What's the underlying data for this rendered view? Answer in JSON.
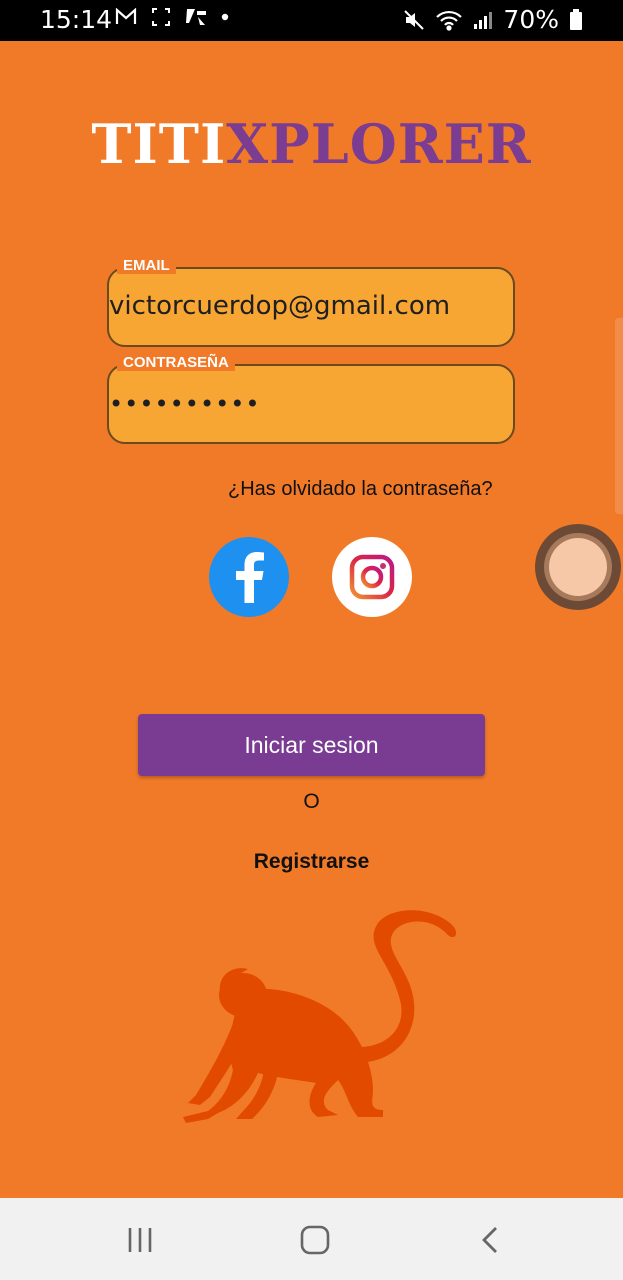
{
  "status_bar": {
    "time": "15:14",
    "battery": "70%",
    "icons": [
      "gmail-icon",
      "screenshot-icon",
      "app-icon",
      "dot-icon"
    ],
    "right_icons": [
      "mute-icon",
      "wifi-icon",
      "signal-icon",
      "battery-icon"
    ]
  },
  "logo": {
    "part1": "TITI",
    "part2": "XPLORER",
    "color1": "#ffffff",
    "color2": "#7b3d91"
  },
  "login": {
    "email_label": "EMAIL",
    "email_value": "victorcuerdop@gmail.com",
    "password_label": "CONTRASEÑA",
    "password_value": "••••••••••",
    "forgot_link": "¿Has olvidado la contraseña?",
    "social": [
      "facebook-icon",
      "instagram-icon"
    ],
    "submit_label": "Iniciar sesion",
    "or_text": "O",
    "register_link": "Registrarse"
  },
  "nav": {
    "buttons": [
      "recents-icon",
      "home-icon",
      "back-icon"
    ]
  },
  "colors": {
    "background": "#f17a29",
    "field": "#f7a634",
    "button": "#7a3c92",
    "monkey": "#e24a00"
  }
}
